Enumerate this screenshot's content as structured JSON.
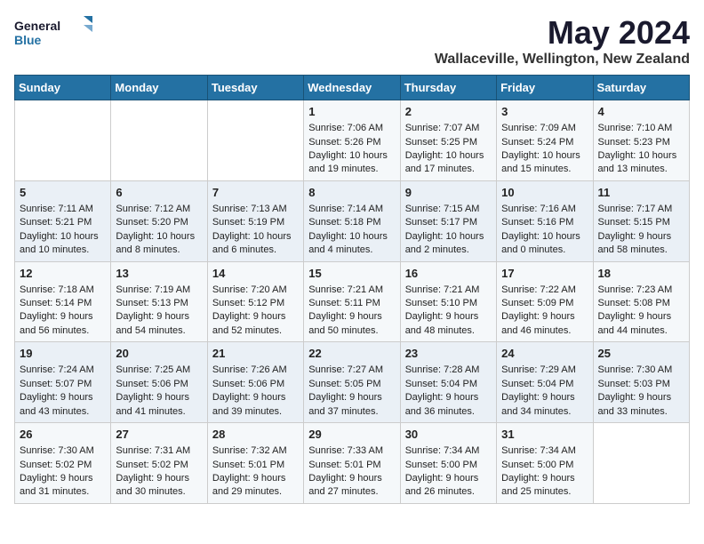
{
  "logo": {
    "line1": "General",
    "line2": "Blue"
  },
  "title": "May 2024",
  "subtitle": "Wallaceville, Wellington, New Zealand",
  "weekdays": [
    "Sunday",
    "Monday",
    "Tuesday",
    "Wednesday",
    "Thursday",
    "Friday",
    "Saturday"
  ],
  "weeks": [
    [
      {
        "day": "",
        "info": ""
      },
      {
        "day": "",
        "info": ""
      },
      {
        "day": "",
        "info": ""
      },
      {
        "day": "1",
        "info": "Sunrise: 7:06 AM\nSunset: 5:26 PM\nDaylight: 10 hours\nand 19 minutes."
      },
      {
        "day": "2",
        "info": "Sunrise: 7:07 AM\nSunset: 5:25 PM\nDaylight: 10 hours\nand 17 minutes."
      },
      {
        "day": "3",
        "info": "Sunrise: 7:09 AM\nSunset: 5:24 PM\nDaylight: 10 hours\nand 15 minutes."
      },
      {
        "day": "4",
        "info": "Sunrise: 7:10 AM\nSunset: 5:23 PM\nDaylight: 10 hours\nand 13 minutes."
      }
    ],
    [
      {
        "day": "5",
        "info": "Sunrise: 7:11 AM\nSunset: 5:21 PM\nDaylight: 10 hours\nand 10 minutes."
      },
      {
        "day": "6",
        "info": "Sunrise: 7:12 AM\nSunset: 5:20 PM\nDaylight: 10 hours\nand 8 minutes."
      },
      {
        "day": "7",
        "info": "Sunrise: 7:13 AM\nSunset: 5:19 PM\nDaylight: 10 hours\nand 6 minutes."
      },
      {
        "day": "8",
        "info": "Sunrise: 7:14 AM\nSunset: 5:18 PM\nDaylight: 10 hours\nand 4 minutes."
      },
      {
        "day": "9",
        "info": "Sunrise: 7:15 AM\nSunset: 5:17 PM\nDaylight: 10 hours\nand 2 minutes."
      },
      {
        "day": "10",
        "info": "Sunrise: 7:16 AM\nSunset: 5:16 PM\nDaylight: 10 hours\nand 0 minutes."
      },
      {
        "day": "11",
        "info": "Sunrise: 7:17 AM\nSunset: 5:15 PM\nDaylight: 9 hours\nand 58 minutes."
      }
    ],
    [
      {
        "day": "12",
        "info": "Sunrise: 7:18 AM\nSunset: 5:14 PM\nDaylight: 9 hours\nand 56 minutes."
      },
      {
        "day": "13",
        "info": "Sunrise: 7:19 AM\nSunset: 5:13 PM\nDaylight: 9 hours\nand 54 minutes."
      },
      {
        "day": "14",
        "info": "Sunrise: 7:20 AM\nSunset: 5:12 PM\nDaylight: 9 hours\nand 52 minutes."
      },
      {
        "day": "15",
        "info": "Sunrise: 7:21 AM\nSunset: 5:11 PM\nDaylight: 9 hours\nand 50 minutes."
      },
      {
        "day": "16",
        "info": "Sunrise: 7:21 AM\nSunset: 5:10 PM\nDaylight: 9 hours\nand 48 minutes."
      },
      {
        "day": "17",
        "info": "Sunrise: 7:22 AM\nSunset: 5:09 PM\nDaylight: 9 hours\nand 46 minutes."
      },
      {
        "day": "18",
        "info": "Sunrise: 7:23 AM\nSunset: 5:08 PM\nDaylight: 9 hours\nand 44 minutes."
      }
    ],
    [
      {
        "day": "19",
        "info": "Sunrise: 7:24 AM\nSunset: 5:07 PM\nDaylight: 9 hours\nand 43 minutes."
      },
      {
        "day": "20",
        "info": "Sunrise: 7:25 AM\nSunset: 5:06 PM\nDaylight: 9 hours\nand 41 minutes."
      },
      {
        "day": "21",
        "info": "Sunrise: 7:26 AM\nSunset: 5:06 PM\nDaylight: 9 hours\nand 39 minutes."
      },
      {
        "day": "22",
        "info": "Sunrise: 7:27 AM\nSunset: 5:05 PM\nDaylight: 9 hours\nand 37 minutes."
      },
      {
        "day": "23",
        "info": "Sunrise: 7:28 AM\nSunset: 5:04 PM\nDaylight: 9 hours\nand 36 minutes."
      },
      {
        "day": "24",
        "info": "Sunrise: 7:29 AM\nSunset: 5:04 PM\nDaylight: 9 hours\nand 34 minutes."
      },
      {
        "day": "25",
        "info": "Sunrise: 7:30 AM\nSunset: 5:03 PM\nDaylight: 9 hours\nand 33 minutes."
      }
    ],
    [
      {
        "day": "26",
        "info": "Sunrise: 7:30 AM\nSunset: 5:02 PM\nDaylight: 9 hours\nand 31 minutes."
      },
      {
        "day": "27",
        "info": "Sunrise: 7:31 AM\nSunset: 5:02 PM\nDaylight: 9 hours\nand 30 minutes."
      },
      {
        "day": "28",
        "info": "Sunrise: 7:32 AM\nSunset: 5:01 PM\nDaylight: 9 hours\nand 29 minutes."
      },
      {
        "day": "29",
        "info": "Sunrise: 7:33 AM\nSunset: 5:01 PM\nDaylight: 9 hours\nand 27 minutes."
      },
      {
        "day": "30",
        "info": "Sunrise: 7:34 AM\nSunset: 5:00 PM\nDaylight: 9 hours\nand 26 minutes."
      },
      {
        "day": "31",
        "info": "Sunrise: 7:34 AM\nSunset: 5:00 PM\nDaylight: 9 hours\nand 25 minutes."
      },
      {
        "day": "",
        "info": ""
      }
    ]
  ]
}
